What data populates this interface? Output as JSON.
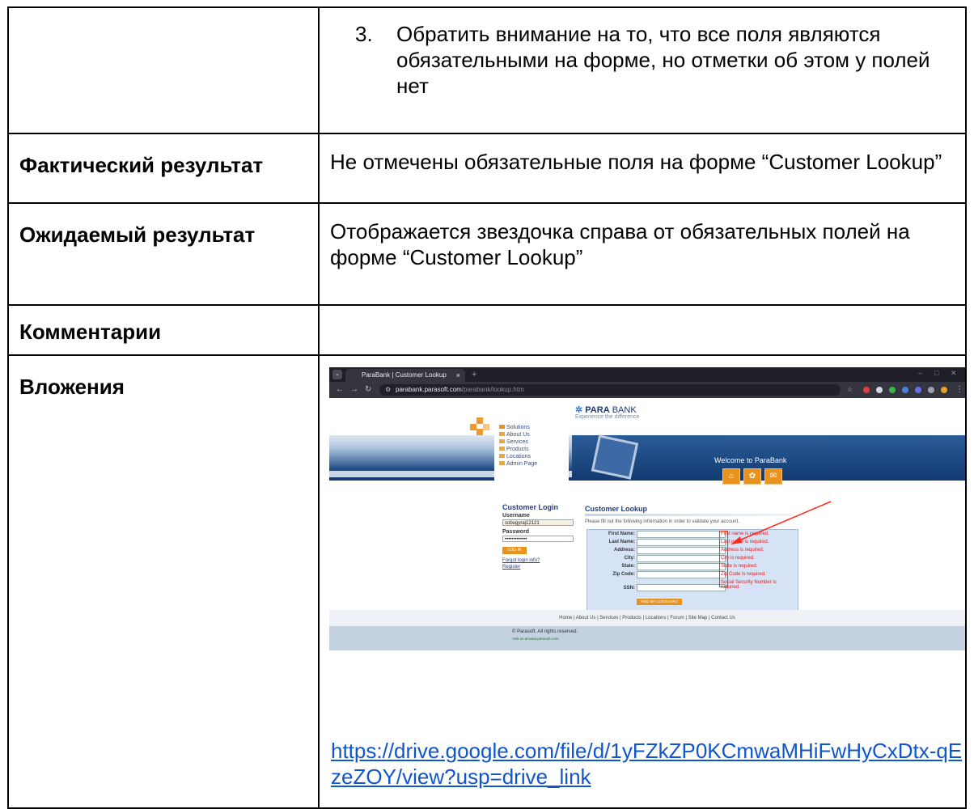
{
  "step3": {
    "num": "3.",
    "text": "Обратить внимание на то, что все поля являются обязательными на форме, но отметки об этом у полей нет"
  },
  "actual": {
    "label": "Фактический результат",
    "value": "Не отмечены обязательные поля на форме “Customer Lookup”"
  },
  "expected": {
    "label": "Ожидаемый результат",
    "value": "Отображается звездочка справа от обязательных полей на форме “Customer Lookup”"
  },
  "comments": {
    "label": "Комментарии"
  },
  "attachments": {
    "label": "Вложения",
    "link": "https://drive.google.com/file/d/1yFZkZP0KCmwaMHiFwHyCxDtx-qEzeZOY/view?usp=drive_link"
  },
  "screenshot": {
    "tab_title": "ParaBank | Customer Lookup",
    "tab_close": "×",
    "new_tab": "+",
    "url_host": "parabank.parasoft.com",
    "url_path": "/parabank/lookup.htm",
    "bank_name_bold": "PARA",
    "bank_name_light": " BANK",
    "tagline": "Experience the difference",
    "menu": [
      "Solutions",
      "About Us",
      "Services",
      "Products",
      "Locations",
      "Admin Page"
    ],
    "welcome": "Welcome to ParaBank",
    "login_title": "Customer Login",
    "username_label": "Username",
    "username_value": "sobugyraj12121",
    "password_label": "Password",
    "password_value": "•••••••••••••",
    "login_button": "LOG IN",
    "forgot_link": "Forgot login info?",
    "register_link": "Register",
    "lookup_title": "Customer Lookup",
    "lookup_desc": "Please fill out the following information in order to validate your account.",
    "fields": [
      {
        "label": "First Name:",
        "error": "First name is required."
      },
      {
        "label": "Last Name:",
        "error": "Last name is required."
      },
      {
        "label": "Address:",
        "error": "Address is required."
      },
      {
        "label": "City:",
        "error": "City is required."
      },
      {
        "label": "State:",
        "error": "State is required."
      },
      {
        "label": "Zip Code:",
        "error": "Zip Code is required."
      },
      {
        "label": "SSN:",
        "error": "Social Security Number is required."
      }
    ],
    "find_button": "FIND MY LOGIN INFO",
    "footer_links": "Home  |  About Us  |  Services  |  Products  |  Locations  |  Forum  |  Site Map  |  Contact Us",
    "copyright": "© Parasoft. All rights reserved.",
    "visit": "Visit us at:www.parasoft.com",
    "colors": {
      "annotation": "#ff2a1a",
      "link": "#1155cc"
    }
  }
}
